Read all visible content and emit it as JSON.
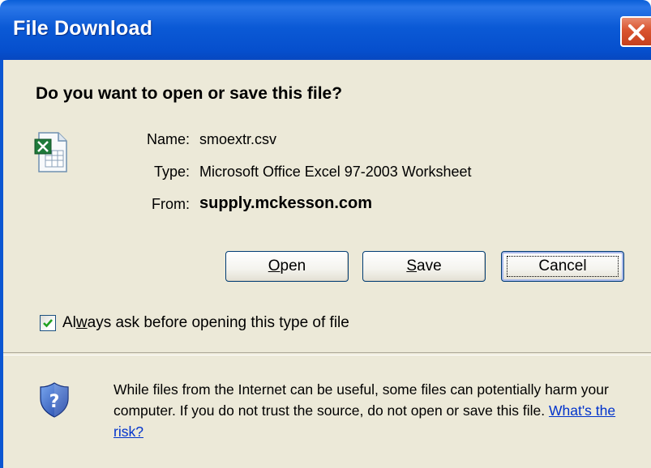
{
  "window": {
    "title": "File Download"
  },
  "dialog": {
    "question": "Do you want to open or save this file?",
    "file": {
      "name_label": "Name:",
      "name_value": "smoextr.csv",
      "type_label": "Type:",
      "type_value": "Microsoft Office Excel 97-2003 Worksheet",
      "from_label": "From:",
      "from_value": "supply.mckesson.com",
      "icon": "excel-file-icon"
    },
    "buttons": {
      "open": {
        "accel": "O",
        "rest": "pen"
      },
      "save": {
        "accel": "S",
        "rest": "ave"
      },
      "cancel": "Cancel"
    },
    "checkbox": {
      "checked": true,
      "label_pre": "Al",
      "label_accel": "w",
      "label_post": "ays ask before opening this type of file"
    },
    "warning": {
      "text": "While files from the Internet can be useful, some files can potentially harm your computer. If you do not trust the source, do not open or save this file.",
      "link": "What's the risk?",
      "icon": "shield-question-icon"
    }
  },
  "colors": {
    "titlebar": "#0b5ad6",
    "close": "#d9542f",
    "client_bg": "#ece9d8",
    "link": "#0033cc"
  }
}
